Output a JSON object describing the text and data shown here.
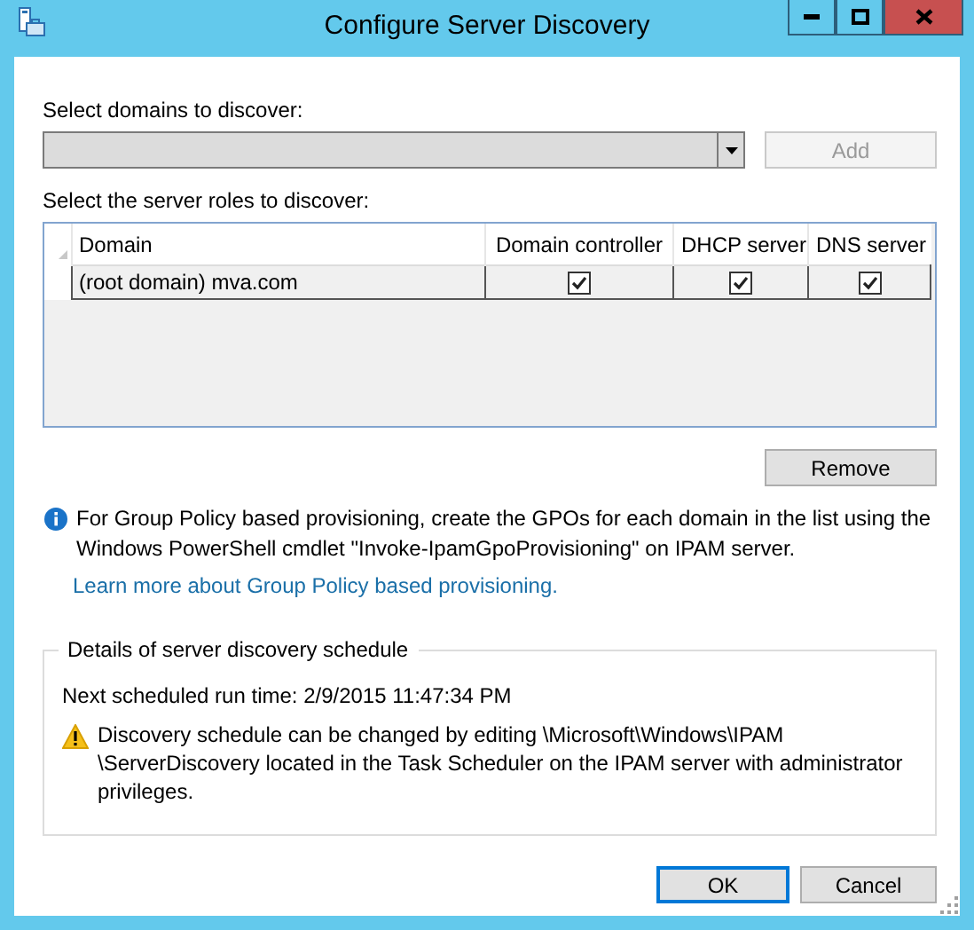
{
  "window": {
    "title": "Configure Server Discovery"
  },
  "domains": {
    "label": "Select domains to discover:",
    "add_button": {
      "label": "Add",
      "disabled": true
    }
  },
  "roles": {
    "label": "Select the server roles to discover:",
    "columns": [
      "Domain",
      "Domain controller",
      "DHCP server",
      "DNS server"
    ],
    "rows": [
      {
        "domain": "(root domain) mva.com",
        "roles": [
          {
            "checked": true
          },
          {
            "checked": true
          },
          {
            "checked": true
          }
        ]
      }
    ]
  },
  "remove_button": {
    "label": "Remove",
    "disabled": false
  },
  "info": {
    "text": "For Group Policy based provisioning, create the GPOs for each domain in the list using the Windows PowerShell cmdlet \"Invoke-IpamGpoProvisioning\" on IPAM server.",
    "link": "Learn more about Group Policy based provisioning."
  },
  "schedule": {
    "title": "Details of server discovery schedule",
    "next_run": "Next scheduled run time: 2/9/2015 11:47:34 PM",
    "warning": "Discovery schedule can be changed by editing \\Microsoft\\Windows\\IPAM \\ServerDiscovery located in the Task Scheduler on the IPAM server with administrator privileges."
  },
  "buttons": [
    {
      "label": "OK",
      "default": true
    },
    {
      "label": "Cancel",
      "default": false
    }
  ]
}
